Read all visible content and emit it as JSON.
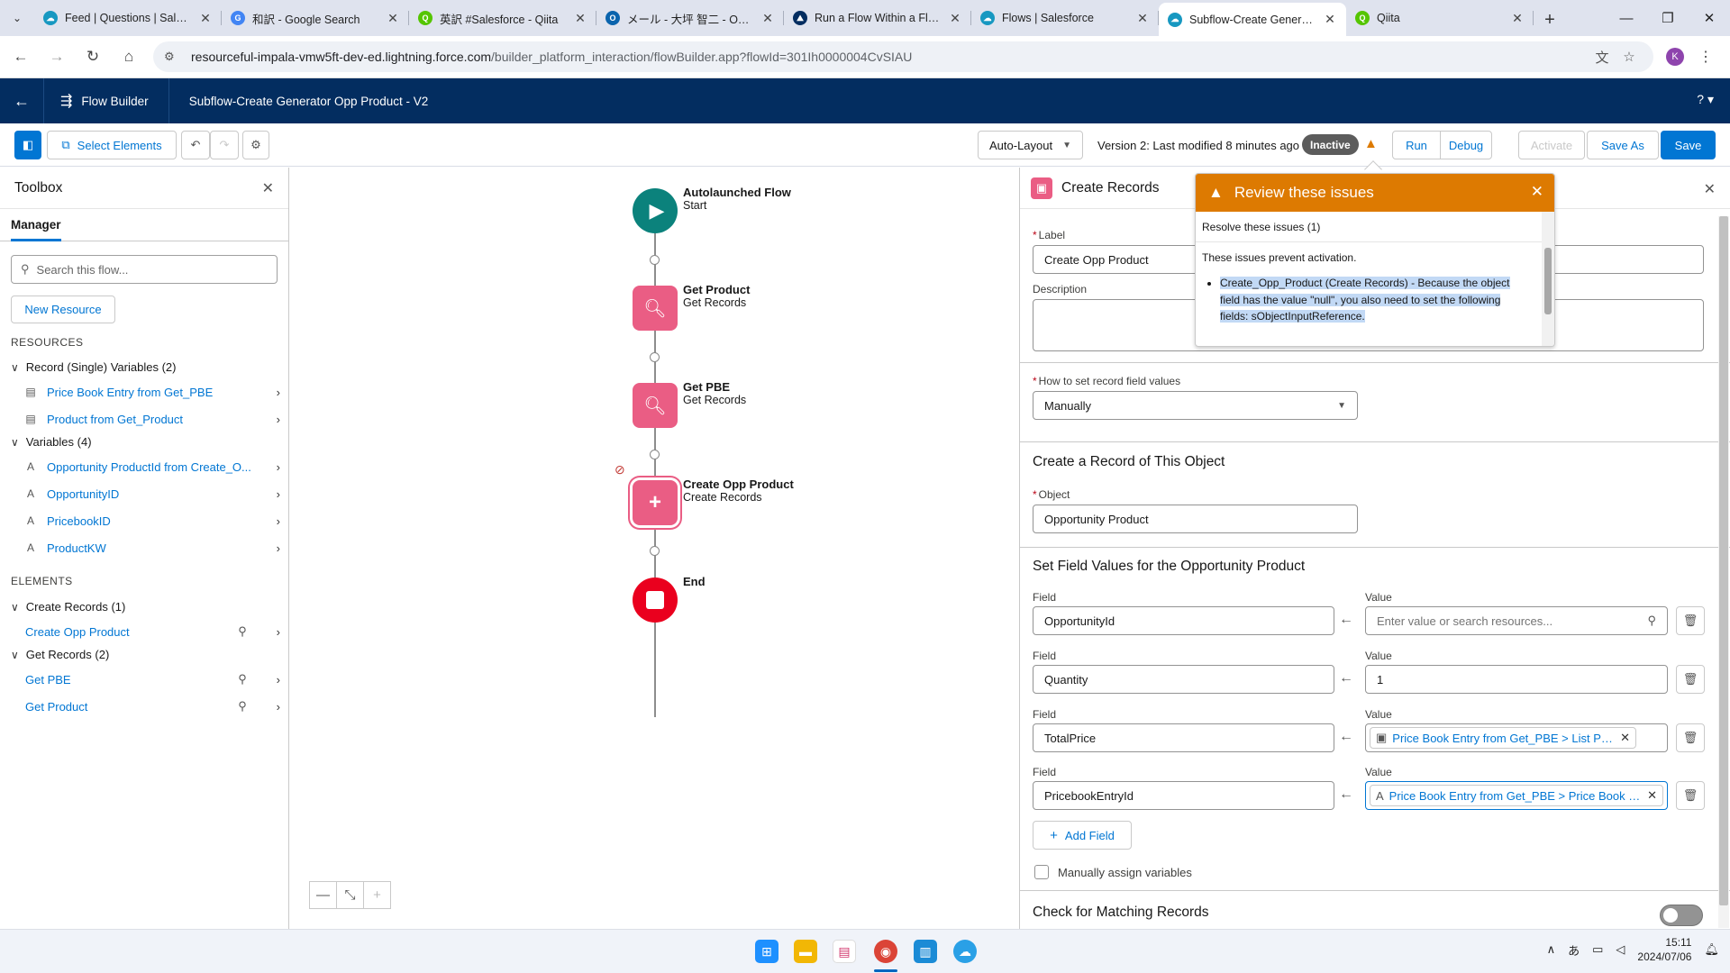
{
  "browser": {
    "tabs": [
      {
        "title": "Feed | Questions | Salesfo",
        "icon": "salesforce-cloud-icon",
        "color": "#1798c1",
        "active": false
      },
      {
        "title": "和訳 - Google Search",
        "icon": "google-g-icon",
        "color": "#4285f4",
        "active": false
      },
      {
        "title": "英訳 #Salesforce - Qiita",
        "icon": "qiita-icon",
        "color": "#55c500",
        "active": false
      },
      {
        "title": "メール - 大坪 智二 - Outloo",
        "icon": "outlook-icon",
        "color": "#0a64ad",
        "active": false
      },
      {
        "title": "Run a Flow Within a Flow",
        "icon": "trailhead-icon",
        "color": "#032d60",
        "active": false
      },
      {
        "title": "Flows | Salesforce",
        "icon": "salesforce-cloud-icon",
        "color": "#1798c1",
        "active": false
      },
      {
        "title": "Subflow-Create Generato",
        "icon": "salesforce-cloud-icon",
        "color": "#1798c1",
        "active": true
      },
      {
        "title": "Qiita",
        "icon": "qiita-icon",
        "color": "#55c500",
        "active": false
      }
    ],
    "url_host": "resourceful-impala-vmw5ft-dev-ed.lightning.force.com",
    "url_path": "/builder_platform_interaction/flowBuilder.app?flowId=301Ih0000004CvSIAU",
    "profile_initial": "K"
  },
  "app": {
    "name": "Flow Builder",
    "flow_title": "Subflow-Create Generator Opp Product - V2",
    "help": "?"
  },
  "toolbar": {
    "select_elements": "Select Elements",
    "layout_mode": "Auto-Layout",
    "version_text": "Version 2: Last modified 8 minutes ago",
    "status": "Inactive",
    "run": "Run",
    "debug": "Debug",
    "activate": "Activate",
    "save_as": "Save As",
    "save": "Save"
  },
  "toolbox": {
    "title": "Toolbox",
    "tab": "Manager",
    "search_placeholder": "Search this flow...",
    "new_resource": "New Resource",
    "resources_heading": "RESOURCES",
    "record_vars_group": "Record (Single) Variables (2)",
    "record_vars": [
      "Price Book Entry from Get_PBE",
      "Product from Get_Product"
    ],
    "variables_group": "Variables (4)",
    "variables": [
      "Opportunity ProductId from Create_O...",
      "OpportunityID",
      "PricebookID",
      "ProductKW"
    ],
    "elements_heading": "ELEMENTS",
    "create_records_group": "Create Records (1)",
    "create_records": [
      "Create Opp Product"
    ],
    "get_records_group": "Get Records (2)",
    "get_records": [
      "Get PBE",
      "Get Product"
    ]
  },
  "canvas": {
    "start": {
      "title": "Autolaunched Flow",
      "subtitle": "Start"
    },
    "nodes": [
      {
        "title": "Get Product",
        "subtitle": "Get Records"
      },
      {
        "title": "Get PBE",
        "subtitle": "Get Records"
      },
      {
        "title": "Create Opp Product",
        "subtitle": "Create Records"
      }
    ],
    "end": {
      "title": "End"
    }
  },
  "panel": {
    "title": "Create Records",
    "label_label": "Label",
    "label_value": "Create Opp Product",
    "description_label": "Description",
    "how_label": "How to set record field values",
    "how_value": "Manually",
    "object_section": "Create a Record of This Object",
    "object_label": "Object",
    "object_value": "Opportunity Product",
    "fields_section": "Set Field Values for the Opportunity Product",
    "field_label": "Field",
    "value_label": "Value",
    "rows": [
      {
        "field": "OpportunityId",
        "value": "",
        "placeholder": "Enter value or search resources..."
      },
      {
        "field": "Quantity",
        "value": "1"
      },
      {
        "field": "TotalPrice",
        "pill": "Price Book Entry from Get_PBE > List Price"
      },
      {
        "field": "PricebookEntryId",
        "pill": "Price Book Entry from Get_PBE > Price Book En..."
      }
    ],
    "add_field": "Add Field",
    "manual_assign": "Manually assign variables",
    "matching_section": "Check for Matching Records"
  },
  "review": {
    "title": "Review these issues",
    "summary": "Resolve these issues (1)",
    "note": "These issues prevent activation.",
    "issue": "Create_Opp_Product (Create Records) - Because the object field has the value \"null\", you also need to set the following fields: sObjectInputReference."
  },
  "taskbar": {
    "time": "15:11",
    "date": "2024/07/06",
    "ime": "あ"
  },
  "colors": {
    "brand_header": "#032d60",
    "accent_blue": "#0176d3",
    "warning_orange": "#dd7a01",
    "start_node": "#0b827c",
    "records_node": "#ea5d84",
    "end_node": "#ea001e"
  }
}
